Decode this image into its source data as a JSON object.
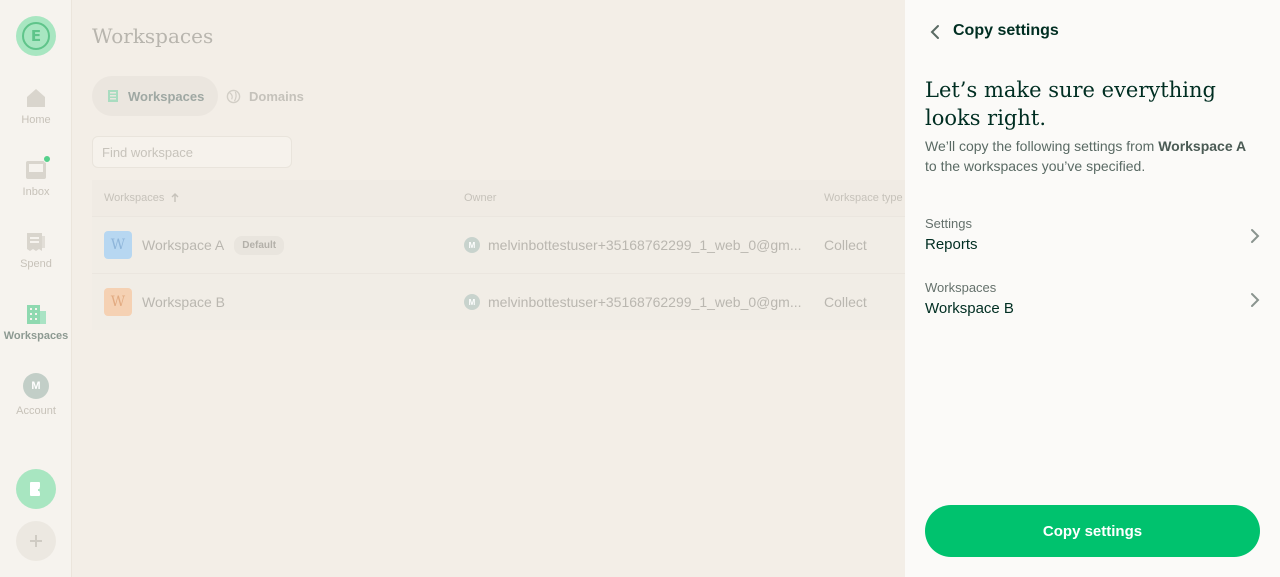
{
  "nav": {
    "items": [
      {
        "label": "Home"
      },
      {
        "label": "Inbox"
      },
      {
        "label": "Spend"
      },
      {
        "label": "Workspaces"
      },
      {
        "label": "Account",
        "avatar_initial": "M"
      }
    ],
    "logo_letter": "E"
  },
  "main": {
    "title": "Workspaces",
    "tabs": [
      {
        "label": "Workspaces"
      },
      {
        "label": "Domains"
      }
    ],
    "search": {
      "placeholder": "Find workspace"
    },
    "table": {
      "columns": [
        "Workspaces",
        "Owner",
        "Workspace type"
      ],
      "rows": [
        {
          "badge": "W",
          "name": "Workspace A",
          "tag": "Default",
          "owner_initial": "M",
          "owner": "melvinbottestuser+35168762299_1_web_0@gm...",
          "type": "Collect",
          "badge_color": "#b7d7f1"
        },
        {
          "badge": "W",
          "name": "Workspace B",
          "tag": "",
          "owner_initial": "M",
          "owner": "melvinbottestuser+35168762299_1_web_0@gm...",
          "type": "Collect",
          "badge_color": "#f5d1b3"
        }
      ]
    }
  },
  "panel": {
    "title": "Copy settings",
    "headline": "Let’s make sure everything looks right.",
    "desc_pre": "We’ll copy the following settings from ",
    "desc_bold": "Workspace A",
    "desc_post": " to the workspaces you’ve specified.",
    "settings_label": "Settings",
    "settings_value": "Reports",
    "workspaces_label": "Workspaces",
    "workspaces_value": "Workspace B",
    "primary_button": "Copy settings"
  },
  "colors": {
    "accent": "#00c26e",
    "text": "#002e22"
  }
}
